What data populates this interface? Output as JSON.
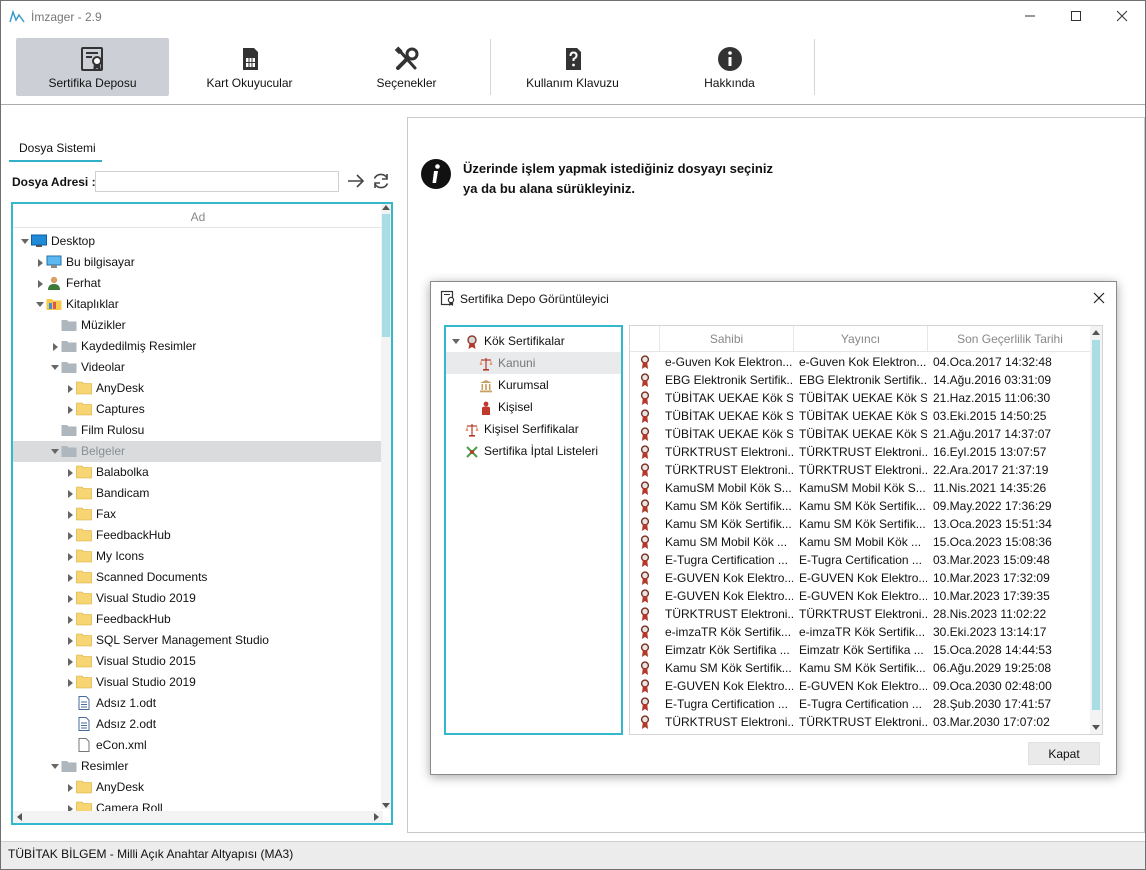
{
  "window": {
    "title": "İmzager - 2.9"
  },
  "ribbon": {
    "buttons": [
      {
        "label": "Sertifika Deposu",
        "icon": "certificate-icon",
        "active": true
      },
      {
        "label": "Kart Okuyucular",
        "icon": "sim-card-icon"
      },
      {
        "label": "Seçenekler",
        "icon": "tools-icon"
      },
      {
        "label": "Kullanım Klavuzu",
        "icon": "help-doc-icon"
      },
      {
        "label": "Hakkında",
        "icon": "info-icon"
      }
    ]
  },
  "left": {
    "tab": "Dosya Sistemi",
    "address_label": "Dosya Adresi :",
    "address_value": "",
    "tree_header": "Ad",
    "tree": [
      {
        "label": "Desktop",
        "icon": "desktop-icon",
        "level": 0,
        "arrow": "expanded"
      },
      {
        "label": "Bu bilgisayar",
        "icon": "computer-icon",
        "level": 1,
        "arrow": "collapsed"
      },
      {
        "label": "Ferhat",
        "icon": "user-icon",
        "level": 1,
        "arrow": "collapsed"
      },
      {
        "label": "Kitaplıklar",
        "icon": "library-folder-icon",
        "level": 1,
        "arrow": "expanded"
      },
      {
        "label": "Müzikler",
        "icon": "gray-folder-icon",
        "level": 2,
        "arrow": "none"
      },
      {
        "label": "Kaydedilmiş Resimler",
        "icon": "gray-folder-icon",
        "level": 2,
        "arrow": "collapsed"
      },
      {
        "label": "Videolar",
        "icon": "gray-folder-icon",
        "level": 2,
        "arrow": "expanded"
      },
      {
        "label": "AnyDesk",
        "icon": "yellow-folder-icon",
        "level": 3,
        "arrow": "collapsed"
      },
      {
        "label": "Captures",
        "icon": "yellow-folder-icon",
        "level": 3,
        "arrow": "collapsed"
      },
      {
        "label": "Film Rulosu",
        "icon": "gray-folder-icon",
        "level": 2,
        "arrow": "none"
      },
      {
        "label": "Belgeler",
        "icon": "gray-folder-icon",
        "level": 2,
        "arrow": "expanded",
        "selected": true
      },
      {
        "label": "Balabolka",
        "icon": "yellow-folder-icon",
        "level": 3,
        "arrow": "collapsed"
      },
      {
        "label": "Bandicam",
        "icon": "yellow-folder-icon",
        "level": 3,
        "arrow": "collapsed"
      },
      {
        "label": "Fax",
        "icon": "yellow-folder-icon",
        "level": 3,
        "arrow": "collapsed"
      },
      {
        "label": "FeedbackHub",
        "icon": "yellow-folder-icon",
        "level": 3,
        "arrow": "collapsed"
      },
      {
        "label": "My Icons",
        "icon": "yellow-folder-icon",
        "level": 3,
        "arrow": "collapsed"
      },
      {
        "label": "Scanned Documents",
        "icon": "yellow-folder-icon",
        "level": 3,
        "arrow": "collapsed"
      },
      {
        "label": "Visual Studio 2019",
        "icon": "yellow-folder-icon",
        "level": 3,
        "arrow": "collapsed"
      },
      {
        "label": "FeedbackHub",
        "icon": "yellow-folder-icon",
        "level": 3,
        "arrow": "collapsed"
      },
      {
        "label": "SQL Server Management Studio",
        "icon": "yellow-folder-icon",
        "level": 3,
        "arrow": "collapsed"
      },
      {
        "label": "Visual Studio 2015",
        "icon": "yellow-folder-icon",
        "level": 3,
        "arrow": "collapsed"
      },
      {
        "label": "Visual Studio 2019",
        "icon": "yellow-folder-icon",
        "level": 3,
        "arrow": "collapsed"
      },
      {
        "label": "Adsız 1.odt",
        "icon": "document-file-icon",
        "level": 3,
        "arrow": "none"
      },
      {
        "label": "Adsız 2.odt",
        "icon": "document-file-icon",
        "level": 3,
        "arrow": "none"
      },
      {
        "label": "eCon.xml",
        "icon": "blank-file-icon",
        "level": 3,
        "arrow": "none"
      },
      {
        "label": "Resimler",
        "icon": "gray-folder-icon",
        "level": 2,
        "arrow": "expanded"
      },
      {
        "label": "AnyDesk",
        "icon": "yellow-folder-icon",
        "level": 3,
        "arrow": "collapsed"
      },
      {
        "label": "Camera Roll",
        "icon": "yellow-folder-icon",
        "level": 3,
        "arrow": "collapsed"
      }
    ]
  },
  "main": {
    "info_line1": "Üzerinde işlem yapmak istediğiniz dosyayı seçiniz",
    "info_line2": "ya da bu alana sürükleyiniz."
  },
  "status": {
    "text": "TÜBİTAK BİLGEM - Milli Açık Anahtar Altyapısı (MA3)"
  },
  "dialog": {
    "title": "Sertifika Depo Görüntüleyici",
    "close_label": "Kapat",
    "tree": [
      {
        "label": "Kök Sertifikalar",
        "icon": "root-cert-icon",
        "level": 0,
        "arrow": true
      },
      {
        "label": "Kanuni",
        "icon": "scales-icon",
        "level": 1,
        "selected": true
      },
      {
        "label": "Kurumsal",
        "icon": "institution-icon",
        "level": 1
      },
      {
        "label": "Kişisel",
        "icon": "person-icon",
        "level": 1
      },
      {
        "label": "Kişisel Serfifikalar",
        "icon": "scales-icon",
        "level": 0
      },
      {
        "label": "Sertifika İptal Listeleri",
        "icon": "crl-icon",
        "level": 0
      }
    ],
    "columns": [
      "Sahibi",
      "Yayıncı",
      "Son Geçerlilik Tarihi"
    ],
    "rows": [
      [
        "e-Guven Kok Elektron...",
        "e-Guven Kok Elektron...",
        "04.Oca.2017 14:32:48"
      ],
      [
        "EBG Elektronik Sertifik...",
        "EBG Elektronik Sertifik...",
        "14.Ağu.2016 03:31:09"
      ],
      [
        "TÜBİTAK UEKAE Kök S...",
        "TÜBİTAK UEKAE Kök S...",
        "21.Haz.2015 11:06:30"
      ],
      [
        "TÜBİTAK UEKAE Kök S...",
        "TÜBİTAK UEKAE Kök S...",
        "03.Eki.2015 14:50:25"
      ],
      [
        "TÜBİTAK UEKAE Kök S...",
        "TÜBİTAK UEKAE Kök S...",
        "21.Ağu.2017 14:37:07"
      ],
      [
        "TÜRKTRUST Elektroni...",
        "TÜRKTRUST Elektroni...",
        "16.Eyl.2015 13:07:57"
      ],
      [
        "TÜRKTRUST Elektroni...",
        "TÜRKTRUST Elektroni...",
        "22.Ara.2017 21:37:19"
      ],
      [
        "KamuSM Mobil Kök S...",
        "KamuSM Mobil Kök S...",
        "11.Nis.2021 14:35:26"
      ],
      [
        "Kamu SM Kök Sertifik...",
        "Kamu SM Kök Sertifik...",
        "09.May.2022 17:36:29"
      ],
      [
        "Kamu SM Kök Sertifik...",
        "Kamu SM Kök Sertifik...",
        "13.Oca.2023 15:51:34"
      ],
      [
        "Kamu SM Mobil Kök ...",
        "Kamu SM Mobil Kök ...",
        "15.Oca.2023 15:08:36"
      ],
      [
        "E-Tugra Certification ...",
        "E-Tugra Certification ...",
        "03.Mar.2023 15:09:48"
      ],
      [
        "E-GUVEN Kok Elektro...",
        "E-GUVEN Kok Elektro...",
        "10.Mar.2023 17:32:09"
      ],
      [
        "E-GUVEN Kok Elektro...",
        "E-GUVEN Kok Elektro...",
        "10.Mar.2023 17:39:35"
      ],
      [
        "TÜRKTRUST Elektroni...",
        "TÜRKTRUST Elektroni...",
        "28.Nis.2023 11:02:22"
      ],
      [
        "e-imzaTR Kök Sertifik...",
        "e-imzaTR Kök Sertifik...",
        "30.Eki.2023 13:14:17"
      ],
      [
        "Eimzatr Kök Sertifika ...",
        "Eimzatr Kök Sertifika ...",
        "15.Oca.2028 14:44:53"
      ],
      [
        "Kamu SM Kök Sertifik...",
        "Kamu SM Kök Sertifik...",
        "06.Ağu.2029 19:25:08"
      ],
      [
        "E-GUVEN Kok Elektro...",
        "E-GUVEN Kok Elektro...",
        "09.Oca.2030 02:48:00"
      ],
      [
        "E-Tugra Certification ...",
        "E-Tugra Certification ...",
        "28.Şub.2030 17:41:57"
      ],
      [
        "TÜRKTRUST Elektroni...",
        "TÜRKTRUST Elektroni...",
        "03.Mar.2030 17:07:02"
      ]
    ]
  },
  "colors": {
    "accent": "#33b8cc",
    "scroll_thumb": "#a8dde6",
    "ribbon_active": "#ccd0d6",
    "selection": "#d9dbdc"
  }
}
